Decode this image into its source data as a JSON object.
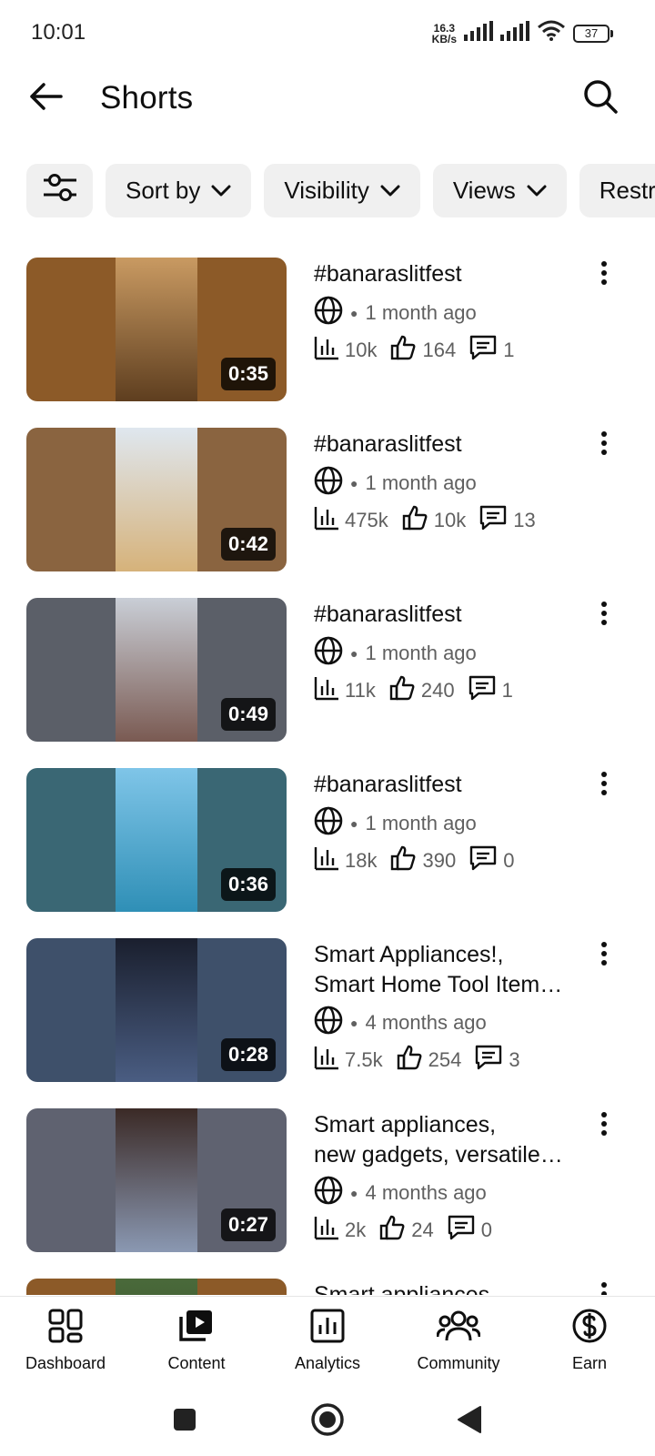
{
  "status_bar": {
    "time": "10:01",
    "net_speed_value": "16.3",
    "net_speed_unit": "KB/s",
    "battery": "37"
  },
  "header": {
    "title": "Shorts",
    "back_icon": "arrow-left-icon",
    "search_icon": "search-icon"
  },
  "filters": {
    "filter_icon": "sliders-icon",
    "chips": [
      {
        "label": "Sort by"
      },
      {
        "label": "Visibility"
      },
      {
        "label": "Views"
      },
      {
        "label": "Restr"
      }
    ]
  },
  "videos": [
    {
      "title_lines": [
        "#banaraslitfest"
      ],
      "visibility_icon": "globe-icon",
      "date": "1 month ago",
      "views": "10k",
      "likes": "164",
      "comments": "1",
      "duration": "0:35",
      "bg": "#8c5a28",
      "center": [
        "#c99a62",
        "#5e3e1f"
      ]
    },
    {
      "title_lines": [
        "#banaraslitfest"
      ],
      "visibility_icon": "globe-icon",
      "date": "1 month ago",
      "views": "475k",
      "likes": "10k",
      "comments": "13",
      "duration": "0:42",
      "bg": "#8a6440",
      "center": [
        "#dfe7ef",
        "#d6b27a"
      ]
    },
    {
      "title_lines": [
        "#banaraslitfest"
      ],
      "visibility_icon": "globe-icon",
      "date": "1 month ago",
      "views": "11k",
      "likes": "240",
      "comments": "1",
      "duration": "0:49",
      "bg": "#5b5f68",
      "center": [
        "#c9ced6",
        "#7a5a52"
      ]
    },
    {
      "title_lines": [
        "#banaraslitfest"
      ],
      "visibility_icon": "globe-icon",
      "date": "1 month ago",
      "views": "18k",
      "likes": "390",
      "comments": "0",
      "duration": "0:36",
      "bg": "#3a6774",
      "center": [
        "#7fc5e8",
        "#2f8fb6"
      ]
    },
    {
      "title_lines": [
        "Smart Appliances!,",
        "Smart Home Tool Item…"
      ],
      "visibility_icon": "globe-icon",
      "date": "4 months ago",
      "views": "7.5k",
      "likes": "254",
      "comments": "3",
      "duration": "0:28",
      "bg": "#3e506a",
      "center": [
        "#1a1f2e",
        "#4a5d82"
      ]
    },
    {
      "title_lines": [
        "Smart appliances,",
        "new gadgets, versatile…"
      ],
      "visibility_icon": "globe-icon",
      "date": "4 months ago",
      "views": "2k",
      "likes": "24",
      "comments": "0",
      "duration": "0:27",
      "bg": "#5f6270",
      "center": [
        "#3b2a26",
        "#8a98b2"
      ]
    },
    {
      "title_lines": [
        "Smart appliances"
      ],
      "visibility_icon": "globe-icon",
      "date": "",
      "views": "",
      "likes": "",
      "comments": "",
      "duration": "",
      "bg": "#8c5a28",
      "center": [
        "#4a6a3a",
        "#2c3f2a"
      ]
    }
  ],
  "bottom_nav": [
    {
      "label": "Dashboard",
      "icon": "dashboard-icon"
    },
    {
      "label": "Content",
      "icon": "content-icon"
    },
    {
      "label": "Analytics",
      "icon": "analytics-icon"
    },
    {
      "label": "Community",
      "icon": "community-icon"
    },
    {
      "label": "Earn",
      "icon": "earn-icon"
    }
  ],
  "system_nav": {
    "recents_icon": "square-icon",
    "home_icon": "circle-icon",
    "back_icon": "triangle-back-icon"
  }
}
